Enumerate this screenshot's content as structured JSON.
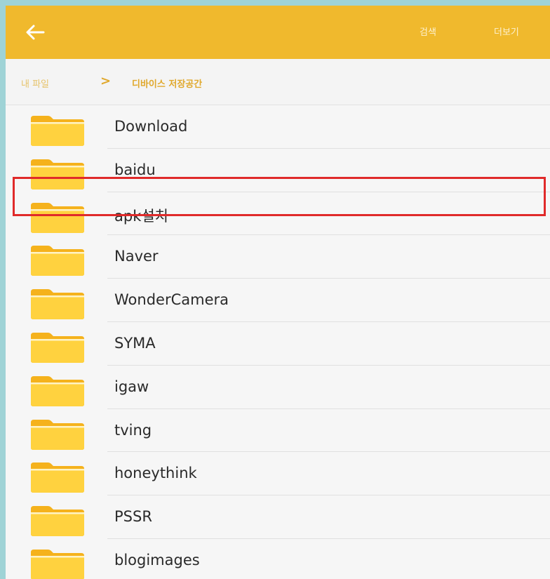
{
  "appbar": {
    "back_icon": "back-arrow-icon",
    "search_label": "검색",
    "more_label": "더보기",
    "background": "#f0b92d"
  },
  "breadcrumb": {
    "root": "내 파일",
    "separator": ">",
    "current": "디바이스 저장공간"
  },
  "folders": [
    {
      "name": "Download"
    },
    {
      "name": "baidu"
    },
    {
      "name": "apk설치",
      "highlighted": true
    },
    {
      "name": "Naver"
    },
    {
      "name": "WonderCamera"
    },
    {
      "name": "SYMA"
    },
    {
      "name": "igaw"
    },
    {
      "name": "tving"
    },
    {
      "name": "honeythink"
    },
    {
      "name": "PSSR"
    },
    {
      "name": "blogimages"
    }
  ],
  "colors": {
    "folder": "#ffd23f",
    "folder_dark": "#f5b21c",
    "highlight": "#e02a2a"
  }
}
